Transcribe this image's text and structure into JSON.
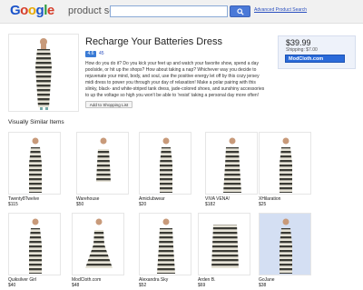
{
  "header": {
    "logo_text": "Google",
    "product_label": "product search",
    "search_value": "",
    "advanced_link": "Advanced Product Search"
  },
  "product": {
    "title": "Recharge Your Batteries Dress",
    "rating": "4.6",
    "rating_count": "45",
    "description": "How do you do it? Do you kick your feet up and watch your favorite show, spend a day poolside, or hit up the shops? How about taking a nap? Whichever way you decide to rejuvenate your mind, body, and soul, use the positive energy let off by this cozy jersey midi dress to power you through your day of relaxation! Make a polar pairing with this slinky, black- and white-striped tank dress, jade-colored shoes, and sunshiny accessories to up the voltage so high you won't be able to 'resist' taking a personal day more often!",
    "add_button": "Add to Shopping List",
    "price": "$39.99",
    "shipping": "Shipping: $7.00",
    "store_button": "ModCloth.com"
  },
  "similar": {
    "heading": "Visually Similar Items",
    "items": [
      {
        "store": "Twenty8Twelve",
        "price": "$115",
        "style": "stripe-tank"
      },
      {
        "store": "Warehouse",
        "price": "$50",
        "style": "stripe-fitted"
      },
      {
        "store": "Amiclubwear",
        "price": "$20",
        "style": "stripe-halter"
      },
      {
        "store": "VIVA VENA!",
        "price": "$182",
        "style": "stripe-strapless"
      },
      {
        "store": "XHilaration",
        "price": "$25",
        "style": "stripe-maxi"
      },
      {
        "store": "Quiksilver Girl",
        "price": "$40",
        "style": "stripe-tank"
      },
      {
        "store": "ModCloth.com",
        "price": "$48",
        "style": "stripe-flare"
      },
      {
        "store": "Alexandra Sky",
        "price": "$52",
        "style": "stripe-strapless"
      },
      {
        "store": "Arden B.",
        "price": "$69",
        "style": "stripe-flat"
      },
      {
        "store": "GoJane",
        "price": "$38",
        "style": "stripe-tank-blue"
      }
    ]
  },
  "colors": {
    "link": "#2a4fbf",
    "accent": "#2a6ad9",
    "stripe_dark": "#3a3a34",
    "stripe_light": "#e7e4d8"
  }
}
